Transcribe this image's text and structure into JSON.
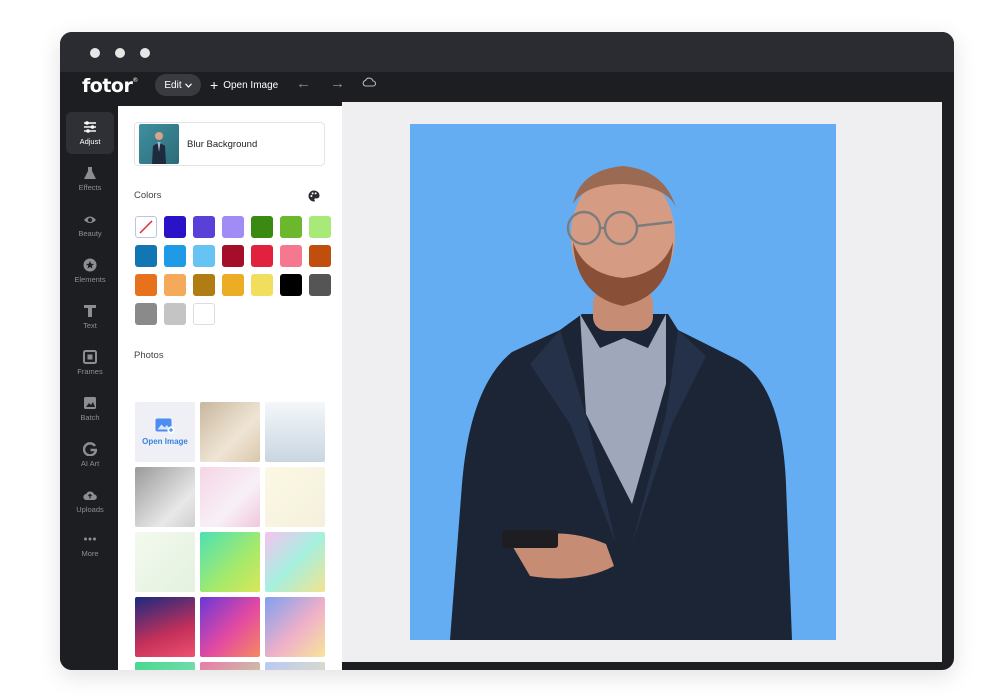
{
  "app": {
    "logo": "fotor",
    "logo_mark": "®"
  },
  "toolbar": {
    "edit_label": "Edit",
    "open_image_label": "Open Image"
  },
  "sidebar": {
    "items": [
      {
        "label": "Adjust",
        "icon": "sliders-icon",
        "active": true
      },
      {
        "label": "Effects",
        "icon": "flask-icon",
        "active": false
      },
      {
        "label": "Beauty",
        "icon": "eye-icon",
        "active": false
      },
      {
        "label": "Elements",
        "icon": "star-icon",
        "active": false
      },
      {
        "label": "Text",
        "icon": "text-icon",
        "active": false
      },
      {
        "label": "Frames",
        "icon": "frame-icon",
        "active": false
      },
      {
        "label": "Batch",
        "icon": "batch-icon",
        "active": false
      },
      {
        "label": "AI Art",
        "icon": "ai-art-icon",
        "active": false
      },
      {
        "label": "Uploads",
        "icon": "cloud-upload-icon",
        "active": false
      },
      {
        "label": "More",
        "icon": "more-icon",
        "active": false
      }
    ]
  },
  "panel": {
    "blur_background_label": "Blur Background",
    "colors_title": "Colors",
    "photos_title": "Photos",
    "open_image_tile": "Open Image",
    "colors": [
      "none",
      "#2a12c8",
      "#5a3fd8",
      "#a18cf5",
      "#3a8a12",
      "#6cb82c",
      "#a8ea78",
      "#1376b4",
      "#1e9ae6",
      "#66c4f4",
      "#a50e28",
      "#e0223e",
      "#f4798e",
      "#c24e0e",
      "#e8711c",
      "#f5a95a",
      "#b07c14",
      "#ecac24",
      "#f0de5c",
      "#000000",
      "#555555",
      "#8a8a8a",
      "#c4c4c4",
      "#ffffff"
    ],
    "photos": [
      "open",
      "linear-gradient(135deg,#c9b79e,#efe5d5 60%,#d9c7ab)",
      "linear-gradient(180deg,#f4f7fa,#c9d6e0)",
      "linear-gradient(135deg,#9a9a9a,#e8e8e8 70%,#cfcfcf)",
      "linear-gradient(135deg,#f5d5e6,#f8f0f7 60%,#efc7dc)",
      "linear-gradient(135deg,#fbf8e4,#f4f0dd)",
      "linear-gradient(135deg,#f3f9ee,#e3f1df)",
      "linear-gradient(135deg,#4de0b4,#a6ea6a 60%,#d9e65a)",
      "linear-gradient(135deg,#f6c2f0,#a5f0e0 50%,#f2e48e)",
      "linear-gradient(160deg,#1a2a80,#c3305a 60%,#ef5070)",
      "linear-gradient(135deg,#6a38d8,#e44aa0 55%,#f58a60)",
      "linear-gradient(135deg,#7fa0f0,#f0b0c8 55%,#f7e59a)",
      "linear-gradient(135deg,#48d890,#8ee0c0)",
      "linear-gradient(135deg,#e87aa8,#b8f0a8)",
      "linear-gradient(135deg,#b8c8f8,#f0e8a8)"
    ]
  },
  "canvas": {
    "background_color": "#65adf2"
  }
}
